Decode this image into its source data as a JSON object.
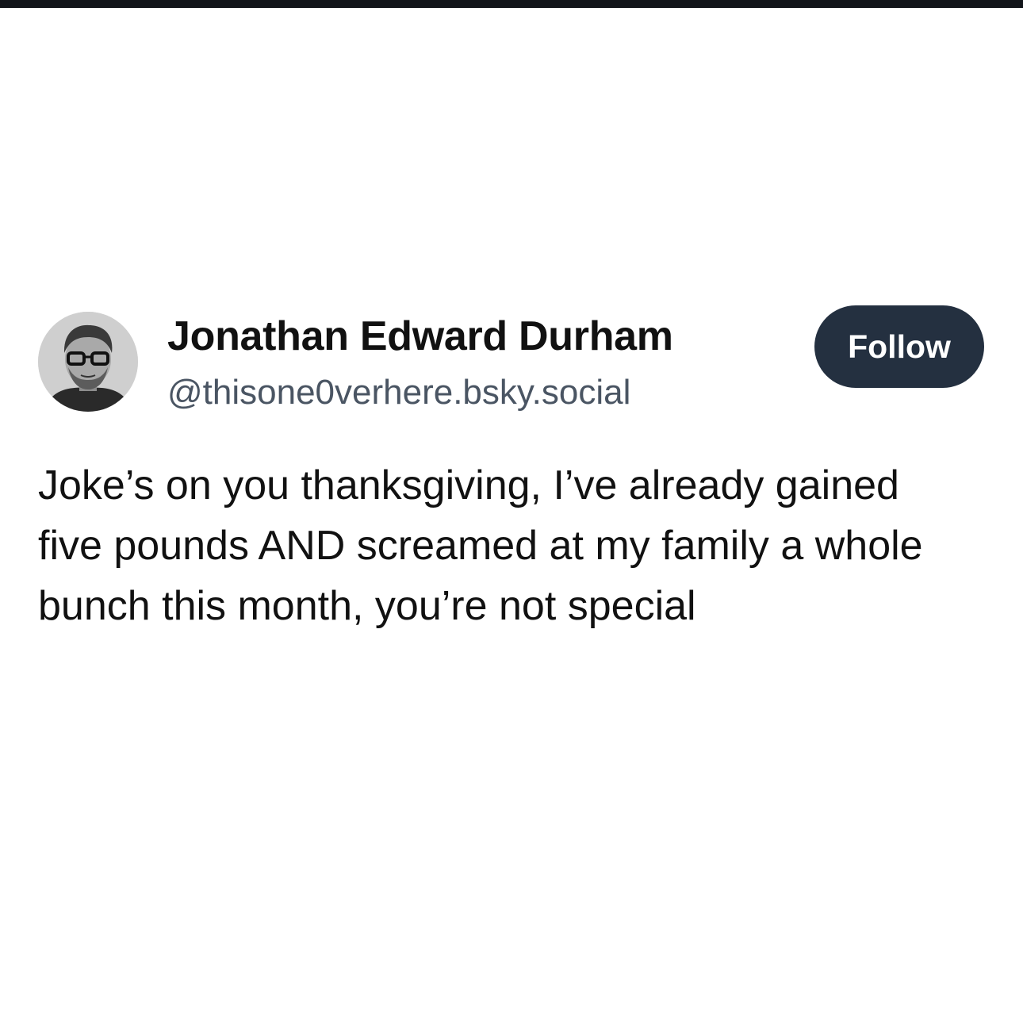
{
  "author": {
    "name": "Jonathan Edward Durham",
    "handle": "@thisone0verhere.bsky.social",
    "avatar_icon": "profile-photo"
  },
  "actions": {
    "follow_label": "Follow"
  },
  "post": {
    "text": "Joke’s on you thanksgiving, I’ve already gained five pounds AND screamed at my family a whole bunch this month, you’re not special"
  },
  "colors": {
    "top_bar": "#12151a",
    "follow_button_bg": "#243040",
    "handle_text": "#4a5563"
  }
}
